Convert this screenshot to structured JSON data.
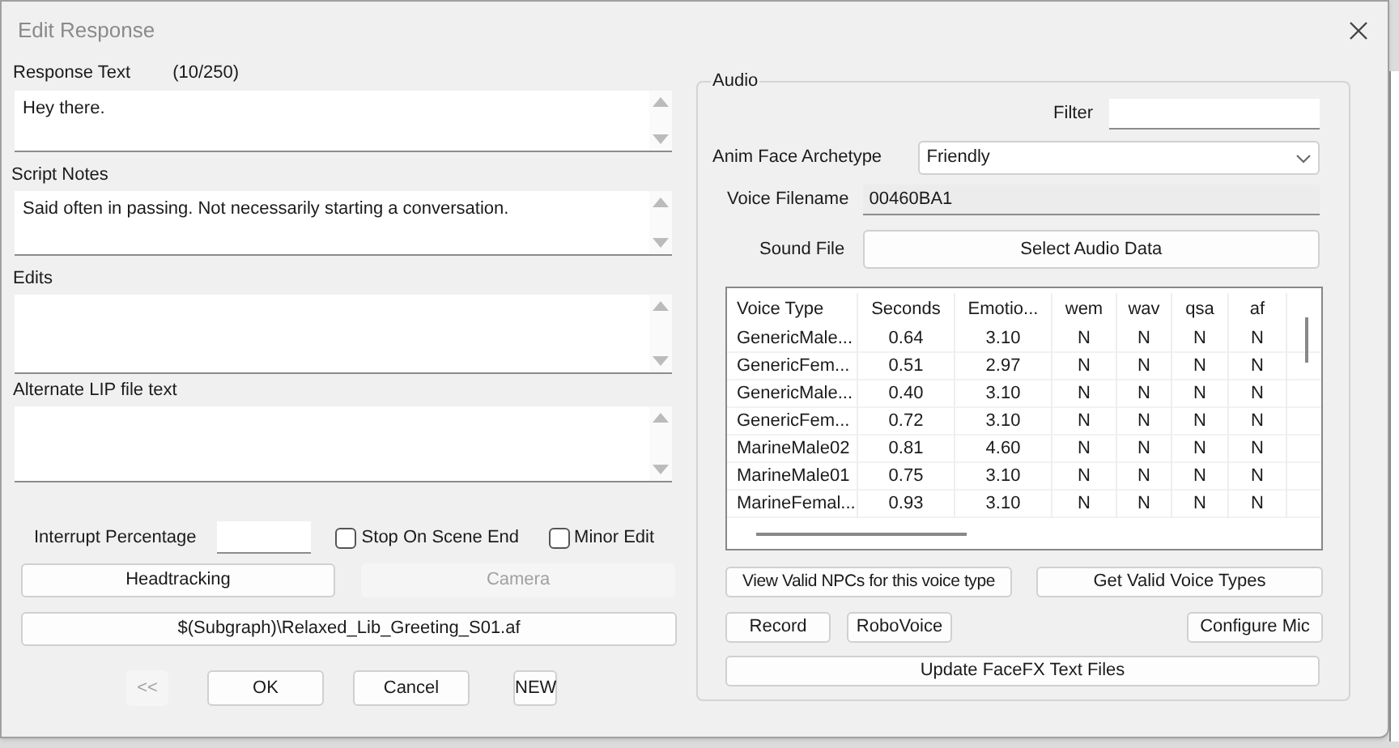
{
  "window": {
    "title": "Edit Response"
  },
  "left": {
    "response_text": {
      "label": "Response Text",
      "count": "(10/250)",
      "value": "Hey there."
    },
    "fields": [
      {
        "label": "Script Notes",
        "value": "Said often in passing. Not necessarily starting a conversation."
      },
      {
        "label": "Edits"
      },
      {
        "label": "Alternate LIP file text"
      }
    ],
    "interrupt_percentage": {
      "label": "Interrupt Percentage"
    },
    "checkboxes": [
      {
        "label": "Stop On Scene End",
        "checked": false
      },
      {
        "label": "Minor Edit",
        "checked": false
      }
    ],
    "buttons": [
      {
        "label": "Headtracking",
        "disabled": false
      },
      {
        "label": "Camera",
        "disabled": true
      }
    ],
    "file_button": "$(Subgraph)\\Relaxed_Lib_Greeting_S01.af"
  },
  "footer_buttons": [
    {
      "label": "<<",
      "disabled": true
    },
    {
      "label": "OK",
      "disabled": false
    },
    {
      "label": "Cancel",
      "disabled": false
    },
    {
      "label": "NEW",
      "disabled": false
    }
  ],
  "audio": {
    "title": "Audio",
    "filter": {
      "label": "Filter"
    },
    "archetype": {
      "label": "Anim Face Archetype",
      "value": "Friendly"
    },
    "voice_filename": {
      "label": "Voice Filename",
      "value": "00460BA1"
    },
    "sound_file": {
      "label": "Sound File",
      "button": "Select Audio Data"
    },
    "table": {
      "columns": [
        "Voice Type",
        "Seconds",
        "Emotio...",
        "wem",
        "wav",
        "qsa",
        "af"
      ],
      "rows": [
        [
          "GenericMale...",
          "0.64",
          "3.10",
          "N",
          "N",
          "N",
          "N"
        ],
        [
          "GenericFem...",
          "0.51",
          "2.97",
          "N",
          "N",
          "N",
          "N"
        ],
        [
          "GenericMale...",
          "0.40",
          "3.10",
          "N",
          "N",
          "N",
          "N"
        ],
        [
          "GenericFem...",
          "0.72",
          "3.10",
          "N",
          "N",
          "N",
          "N"
        ],
        [
          "MarineMale02",
          "0.81",
          "4.60",
          "N",
          "N",
          "N",
          "N"
        ],
        [
          "MarineMale01",
          "0.75",
          "3.10",
          "N",
          "N",
          "N",
          "N"
        ],
        [
          "MarineFemal...",
          "0.93",
          "3.10",
          "N",
          "N",
          "N",
          "N"
        ]
      ]
    },
    "buttons": [
      "View Valid NPCs for this voice type",
      "Get Valid Voice Types",
      "Record",
      "RoboVoice",
      "Configure Mic",
      "Update FaceFX Text Files"
    ]
  }
}
